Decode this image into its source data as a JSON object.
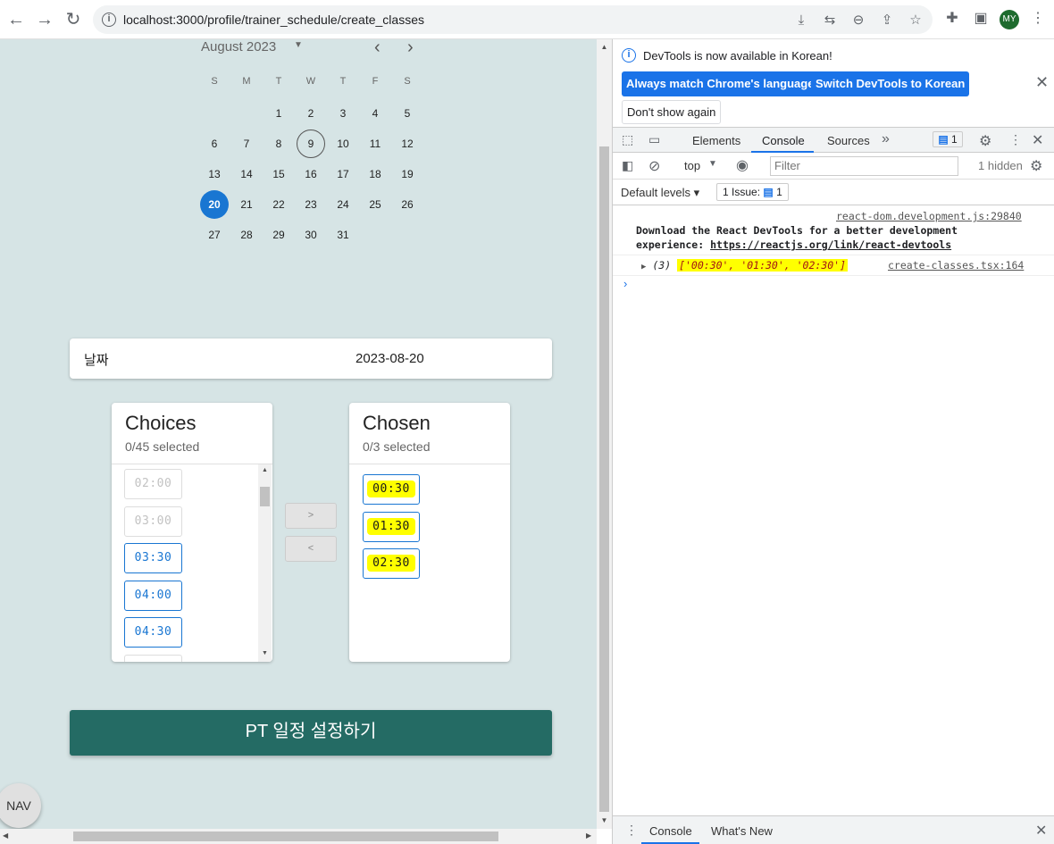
{
  "browser": {
    "url": "localhost:3000/profile/trainer_schedule/create_classes",
    "avatar_initials": "MY"
  },
  "calendar": {
    "month_label": "August 2023",
    "weekdays": [
      "S",
      "M",
      "T",
      "W",
      "T",
      "F",
      "S"
    ],
    "days": [
      [
        "",
        "",
        "1",
        "2",
        "3",
        "4",
        "5"
      ],
      [
        "6",
        "7",
        "8",
        "9",
        "10",
        "11",
        "12"
      ],
      [
        "13",
        "14",
        "15",
        "16",
        "17",
        "18",
        "19"
      ],
      [
        "20",
        "21",
        "22",
        "23",
        "24",
        "25",
        "26"
      ],
      [
        "27",
        "28",
        "29",
        "30",
        "31",
        "",
        ""
      ]
    ],
    "today": "9",
    "selected": "20"
  },
  "date_card": {
    "label": "날짜",
    "value": "2023-08-20"
  },
  "choices": {
    "title": "Choices",
    "subtitle": "0/45 selected",
    "items": [
      {
        "label": "02:00",
        "enabled": false
      },
      {
        "label": "03:00",
        "enabled": false
      },
      {
        "label": "03:30",
        "enabled": true
      },
      {
        "label": "04:00",
        "enabled": true
      },
      {
        "label": "04:30",
        "enabled": true
      }
    ]
  },
  "chosen": {
    "title": "Chosen",
    "subtitle": "0/3 selected",
    "items": [
      "00:30",
      "01:30",
      "02:30"
    ]
  },
  "transfer": {
    "right_label": ">",
    "left_label": "<"
  },
  "submit_label": "PT 일정 설정하기",
  "nav_label": "NAV",
  "devtools": {
    "banner_text": "DevTools is now available in Korean!",
    "btn_match": "Always match Chrome's language",
    "btn_switch": "Switch DevTools to Korean",
    "btn_dont_show": "Don't show again",
    "tabs": [
      "Elements",
      "Console",
      "Sources"
    ],
    "message_count": "1",
    "context": "top",
    "filter_placeholder": "Filter",
    "hidden_label": "1 hidden",
    "levels_label": "Default levels",
    "issue_label": "1 Issue:",
    "issue_count": "1",
    "log1_source": "react-dom.development.js:29840",
    "log1_text": "Download the React DevTools for a better development",
    "log1_text2": "experience: ",
    "log1_link": "https://reactjs.org/link/react-devtools",
    "log2_count": "(3)",
    "log2_array": "['00:30', '01:30', '02:30']",
    "log2_source": "create-classes.tsx:164",
    "drawer_tabs": [
      "Console",
      "What's New"
    ]
  }
}
